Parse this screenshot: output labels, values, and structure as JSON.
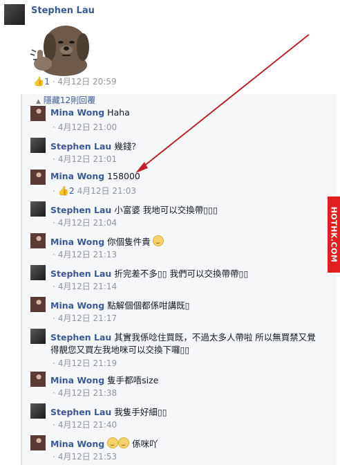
{
  "post": {
    "author": "Stephen Lau",
    "like_count": "1",
    "timestamp": "4月12日 20:59"
  },
  "replies_toggle": "隱藏12則回覆",
  "replies": [
    {
      "author": "Mina Wong",
      "text": "Haha",
      "time": "4月12日 21:00",
      "who": "mina"
    },
    {
      "author": "Stephen Lau",
      "text": "幾錢？",
      "time": "4月12日 21:01",
      "who": "stephen"
    },
    {
      "author": "Mina Wong",
      "text": "158000",
      "time": "4月12日 21:03",
      "who": "mina",
      "likes": "2"
    },
    {
      "author": "Stephen Lau",
      "text": "小富婆 我地可以交換帶▯▯▯",
      "time": "4月12日 21:04",
      "who": "stephen"
    },
    {
      "author": "Mina Wong",
      "text": "你個隻件貴",
      "time": "4月12日 21:13",
      "who": "mina",
      "emoji_count": 1
    },
    {
      "author": "Stephen Lau",
      "text": "折完差不多▯▯ 我們可以交換帶帶▯▯",
      "time": "4月12日 21:14",
      "who": "stephen"
    },
    {
      "author": "Mina Wong",
      "text": "點解個個都係咁講既▯",
      "time": "4月12日 21:17",
      "who": "mina"
    },
    {
      "author": "Stephen Lau",
      "text": "其實我係唸住買既，不過太多人帶啦 所以無買禁又覺",
      "text2": "得靚您又買左我地咪可以交換下囉▯▯",
      "time": "4月12日 21:19",
      "who": "stephen"
    },
    {
      "author": "Mina Wong",
      "text": "隻手都唔size",
      "time": "4月12日 21:38",
      "who": "mina"
    },
    {
      "author": "Stephen Lau",
      "text": "我隻手好細▯▯",
      "time": "4月12日 21:40",
      "who": "stephen"
    },
    {
      "author": "Mina Wong",
      "text": "係咪吖",
      "time": "4月12日 21:53",
      "who": "mina",
      "emoji_count": 2
    }
  ],
  "watermark": "HOTHK.COM",
  "colors": {
    "name": "#3b5998",
    "meta": "#90949c",
    "arrow": "#c0202a",
    "watermark": "#e02020"
  }
}
